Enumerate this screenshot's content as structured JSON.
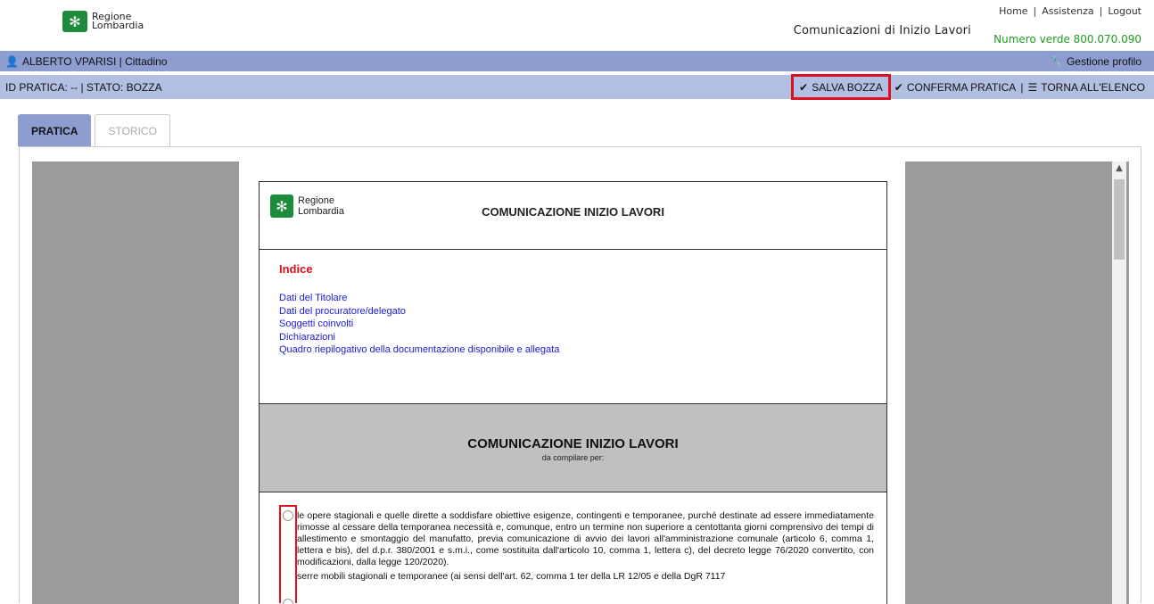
{
  "header": {
    "logo_line1": "Regione",
    "logo_line2": "Lombardia",
    "app_title": "Comunicazioni di Inizio Lavori",
    "numero_verde": "Numero verde 800.070.090",
    "links": {
      "home": "Home",
      "assistenza": "Assistenza",
      "logout": "Logout",
      "separator": "|"
    }
  },
  "userbar": {
    "user": "ALBERTO VPARISI | Cittadino",
    "profile": "Gestione profilo"
  },
  "statusbar": {
    "info": "ID PRATICA: -- |  STATO: BOZZA",
    "salva": "SALVA BOZZA",
    "conferma": "CONFERMA PRATICA",
    "separator": "|",
    "torna": "TORNA ALL'ELENCO"
  },
  "tabs": [
    {
      "label": "PRATICA",
      "active": true
    },
    {
      "label": "STORICO",
      "active": false
    }
  ],
  "document": {
    "logo_line1": "Regione",
    "logo_line2": "Lombardia",
    "title": "COMUNICAZIONE INIZIO LAVORI",
    "indice_title": "Indice",
    "indice_links": [
      "Dati del Titolare",
      "Dati del procuratore/delegato",
      "Soggetti coinvolti",
      "Dichiarazioni",
      "Quadro riepilogativo della documentazione disponibile e allegata"
    ],
    "section_title": "COMUNICAZIONE INIZIO LAVORI",
    "section_subtitle": "da compilare per:",
    "options": [
      "le opere stagionali e quelle dirette a soddisfare obiettive esigenze, contingenti e temporanee, purché destinate ad essere immediatamente rimosse al cessare della temporanea necessità e, comunque, entro un termine non superiore a centottanta giorni comprensivo dei tempi di allestimento e smontaggio del manufatto, previa comunicazione di avvio dei lavori all'amministrazione comunale (articolo 6, comma 1, lettera e bis), del d.p.r. 380/2001 e s.m.i., come sostituita dall'articolo 10, comma 1, lettera c), del decreto legge 76/2020 convertito, con modificazioni, dalla legge 120/2020).",
      "serre mobili stagionali e temporanee (ai sensi dell'art. 62, comma 1 ter della LR 12/05 e della DgR 7117"
    ]
  }
}
